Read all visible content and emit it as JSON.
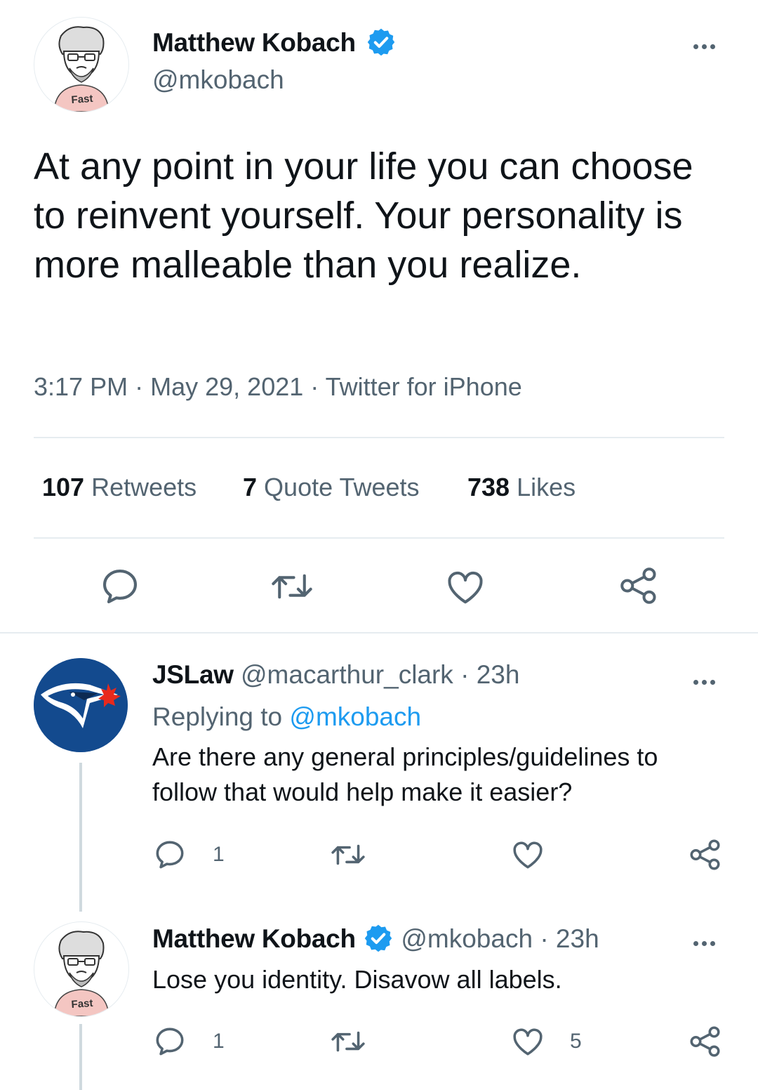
{
  "main_tweet": {
    "author_name": "Matthew Kobach",
    "author_handle": "@mkobach",
    "avatar_label": "Fast",
    "text": "At any point in your life you can choose to reinvent yourself. Your personality is more malleable than you realize.",
    "time": "3:17 PM",
    "date": "May 29, 2021",
    "source": "Twitter for iPhone",
    "sep": "·",
    "stats": {
      "retweets_count": "107",
      "retweets_label": "Retweets",
      "quotes_count": "7",
      "quotes_label": "Quote Tweets",
      "likes_count": "738",
      "likes_label": "Likes"
    }
  },
  "replies": [
    {
      "author_name": "JSLaw",
      "author_handle": "@macarthur_clark",
      "time": "· 23h",
      "replying_prefix": "Replying to",
      "replying_to": "@mkobach",
      "text": "Are there any general principles/guidelines to follow that would help make it easier?",
      "reply_count": "1",
      "retweet_count": "",
      "like_count": ""
    },
    {
      "author_name": "Matthew Kobach",
      "author_handle": "@mkobach",
      "avatar_label": "Fast",
      "time": "· 23h",
      "text": "Lose you identity. Disavow all labels.",
      "reply_count": "1",
      "retweet_count": "",
      "like_count": "5"
    }
  ],
  "colors": {
    "accent": "#1d9bf0",
    "secondary_text": "#536471",
    "divider": "#e6ecf0",
    "jays_blue": "#134a8e",
    "maple_red": "#e8291c"
  },
  "icons": [
    "more-icon",
    "verified-badge-icon",
    "reply-icon",
    "retweet-icon",
    "like-icon",
    "share-icon"
  ]
}
